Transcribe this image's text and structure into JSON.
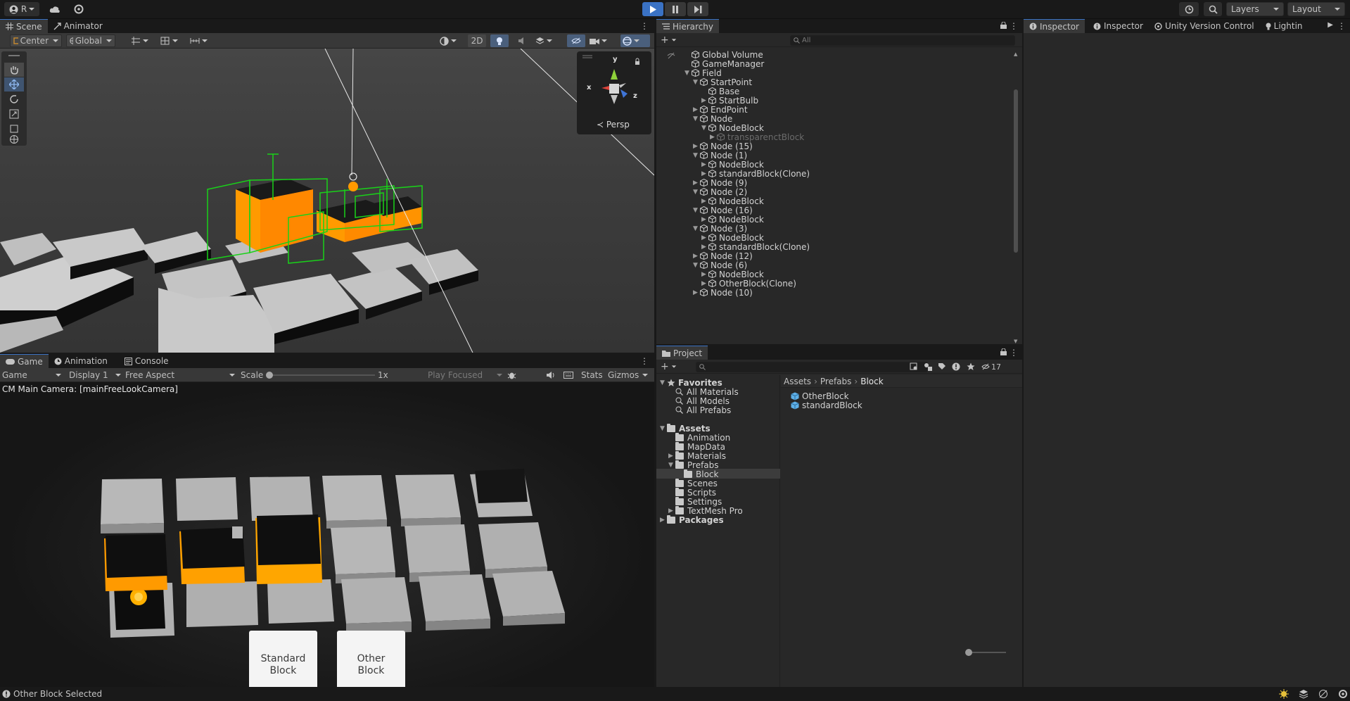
{
  "toolbar": {
    "account_label": "R",
    "layers_label": "Layers",
    "layout_label": "Layout"
  },
  "scene": {
    "tabs": [
      {
        "label": "Scene"
      },
      {
        "label": "Animator"
      }
    ],
    "pivot_label": "Center",
    "space_label": "Global",
    "mode_2d_label": "2D",
    "persp_label": "Persp",
    "axis_x": "x",
    "axis_y": "y",
    "axis_z": "z"
  },
  "game": {
    "tabs": [
      {
        "label": "Game"
      },
      {
        "label": "Animation"
      },
      {
        "label": "Console"
      }
    ],
    "view_label": "Game",
    "display_label": "Display 1",
    "aspect_label": "Free Aspect",
    "scale_label": "Scale",
    "scale_value": "1x",
    "play_focused_label": "Play Focused",
    "stats_label": "Stats",
    "gizmos_label": "Gizmos",
    "camera_text": "CM Main Camera: [mainFreeLookCamera]",
    "buttons": {
      "standard": "Standard\nBlock",
      "other": "Other\nBlock"
    }
  },
  "hierarchy": {
    "title": "Hierarchy",
    "search_placeholder": "All",
    "items": [
      {
        "label": "Global Volume",
        "depth": 0,
        "arrow": ""
      },
      {
        "label": "GameManager",
        "depth": 0,
        "arrow": ""
      },
      {
        "label": "Field",
        "depth": 0,
        "arrow": "▼"
      },
      {
        "label": "StartPoint",
        "depth": 1,
        "arrow": "▼"
      },
      {
        "label": "Base",
        "depth": 2,
        "arrow": ""
      },
      {
        "label": "StartBulb",
        "depth": 2,
        "arrow": "▶"
      },
      {
        "label": "EndPoint",
        "depth": 1,
        "arrow": "▶"
      },
      {
        "label": "Node",
        "depth": 1,
        "arrow": "▼"
      },
      {
        "label": "NodeBlock",
        "depth": 2,
        "arrow": "▼"
      },
      {
        "label": "transparenctBlock",
        "depth": 3,
        "arrow": "▶",
        "dim": true
      },
      {
        "label": "Node (15)",
        "depth": 1,
        "arrow": "▶"
      },
      {
        "label": "Node (1)",
        "depth": 1,
        "arrow": "▼"
      },
      {
        "label": "NodeBlock",
        "depth": 2,
        "arrow": "▶"
      },
      {
        "label": "standardBlock(Clone)",
        "depth": 2,
        "arrow": "▶"
      },
      {
        "label": "Node (9)",
        "depth": 1,
        "arrow": "▶"
      },
      {
        "label": "Node (2)",
        "depth": 1,
        "arrow": "▼"
      },
      {
        "label": "NodeBlock",
        "depth": 2,
        "arrow": "▶"
      },
      {
        "label": "Node (16)",
        "depth": 1,
        "arrow": "▼"
      },
      {
        "label": "NodeBlock",
        "depth": 2,
        "arrow": "▶"
      },
      {
        "label": "Node (3)",
        "depth": 1,
        "arrow": "▼"
      },
      {
        "label": "NodeBlock",
        "depth": 2,
        "arrow": "▶"
      },
      {
        "label": "standardBlock(Clone)",
        "depth": 2,
        "arrow": "▶"
      },
      {
        "label": "Node (12)",
        "depth": 1,
        "arrow": "▶"
      },
      {
        "label": "Node (6)",
        "depth": 1,
        "arrow": "▼"
      },
      {
        "label": "NodeBlock",
        "depth": 2,
        "arrow": "▶"
      },
      {
        "label": "OtherBlock(Clone)",
        "depth": 2,
        "arrow": "▶"
      },
      {
        "label": "Node (10)",
        "depth": 1,
        "arrow": "▶"
      }
    ]
  },
  "project": {
    "title": "Project",
    "hidden_count": "17",
    "favorites_label": "Favorites",
    "favorites": [
      {
        "label": "All Materials"
      },
      {
        "label": "All Models"
      },
      {
        "label": "All Prefabs"
      }
    ],
    "assets_label": "Assets",
    "assets": [
      {
        "label": "Animation",
        "depth": 1,
        "arrow": ""
      },
      {
        "label": "MapData",
        "depth": 1,
        "arrow": ""
      },
      {
        "label": "Materials",
        "depth": 1,
        "arrow": "▶"
      },
      {
        "label": "Prefabs",
        "depth": 1,
        "arrow": "▼"
      },
      {
        "label": "Block",
        "depth": 2,
        "arrow": "",
        "selected": true
      },
      {
        "label": "Scenes",
        "depth": 1,
        "arrow": ""
      },
      {
        "label": "Scripts",
        "depth": 1,
        "arrow": ""
      },
      {
        "label": "Settings",
        "depth": 1,
        "arrow": ""
      },
      {
        "label": "TextMesh Pro",
        "depth": 1,
        "arrow": "▶"
      }
    ],
    "packages_label": "Packages",
    "breadcrumb": [
      "Assets",
      "Prefabs",
      "Block"
    ],
    "files": [
      {
        "label": "OtherBlock"
      },
      {
        "label": "standardBlock"
      }
    ]
  },
  "inspector": {
    "tabs": [
      {
        "label": "Inspector"
      },
      {
        "label": "Inspector"
      },
      {
        "label": "Unity Version Control"
      },
      {
        "label": "Lightin"
      }
    ]
  },
  "status": {
    "text": "Other Block Selected"
  },
  "colors": {
    "accent": "#3a72c4",
    "selection_orange": "#ff9a00",
    "gizmo_green": "#19d119"
  }
}
